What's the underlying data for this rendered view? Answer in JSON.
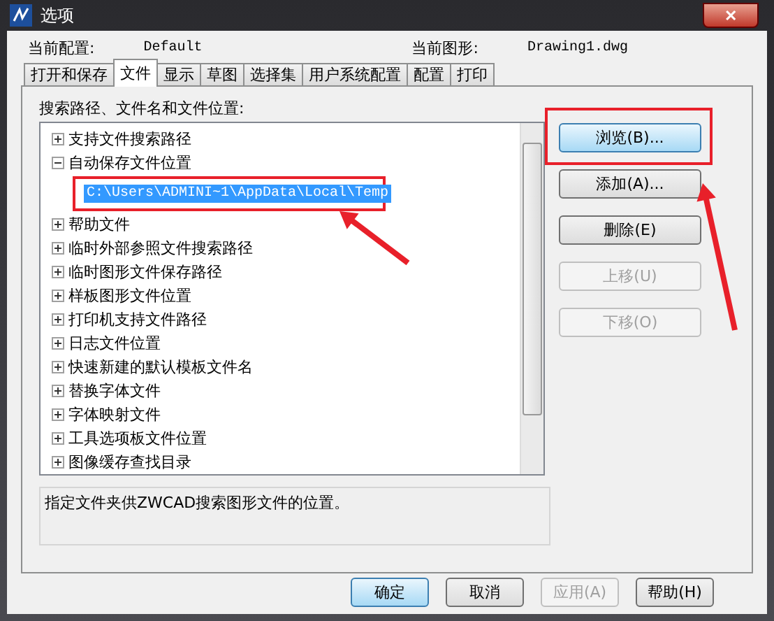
{
  "window": {
    "title": "选项",
    "close": "✕"
  },
  "header": {
    "profile_label": "当前配置:",
    "profile_value": "Default",
    "drawing_label": "当前图形:",
    "drawing_value": "Drawing1.dwg"
  },
  "tabs": [
    {
      "label": "打开和保存",
      "selected": false
    },
    {
      "label": "文件",
      "selected": true
    },
    {
      "label": "显示",
      "selected": false
    },
    {
      "label": "草图",
      "selected": false
    },
    {
      "label": "选择集",
      "selected": false
    },
    {
      "label": "用户系统配置",
      "selected": false
    },
    {
      "label": "配置",
      "selected": false
    },
    {
      "label": "打印",
      "selected": false
    }
  ],
  "tree_label": "搜索路径、文件名和文件位置:",
  "tree": [
    {
      "label": "支持文件搜索路径",
      "expanded": false
    },
    {
      "label": "自动保存文件位置",
      "expanded": true,
      "children": [
        {
          "label": "C:\\Users\\ADMINI~1\\AppData\\Local\\Temp",
          "selected": true
        }
      ]
    },
    {
      "label": "帮助文件",
      "expanded": false
    },
    {
      "label": "临时外部参照文件搜索路径",
      "expanded": false
    },
    {
      "label": "临时图形文件保存路径",
      "expanded": false
    },
    {
      "label": "样板图形文件位置",
      "expanded": false
    },
    {
      "label": "打印机支持文件路径",
      "expanded": false
    },
    {
      "label": "日志文件位置",
      "expanded": false
    },
    {
      "label": "快速新建的默认模板文件名",
      "expanded": false
    },
    {
      "label": "替换字体文件",
      "expanded": false
    },
    {
      "label": "字体映射文件",
      "expanded": false
    },
    {
      "label": "工具选项板文件位置",
      "expanded": false
    },
    {
      "label": "图像缓存查找目录",
      "expanded": false
    }
  ],
  "side_buttons": [
    {
      "label": "浏览(B)...",
      "disabled": false,
      "focused": true
    },
    {
      "label": "添加(A)...",
      "disabled": false,
      "focused": false
    },
    {
      "label": "删除(E)",
      "disabled": false,
      "focused": false
    },
    {
      "label": "上移(U)",
      "disabled": true,
      "focused": false
    },
    {
      "label": "下移(O)",
      "disabled": true,
      "focused": false
    }
  ],
  "description": "指定文件夹供ZWCAD搜索图形文件的位置。",
  "footer_buttons": [
    {
      "label": "确定",
      "disabled": false,
      "focused": true
    },
    {
      "label": "取消",
      "disabled": false,
      "focused": false
    },
    {
      "label": "应用(A)",
      "disabled": true,
      "focused": false
    },
    {
      "label": "帮助(H)",
      "disabled": false,
      "focused": false
    }
  ]
}
